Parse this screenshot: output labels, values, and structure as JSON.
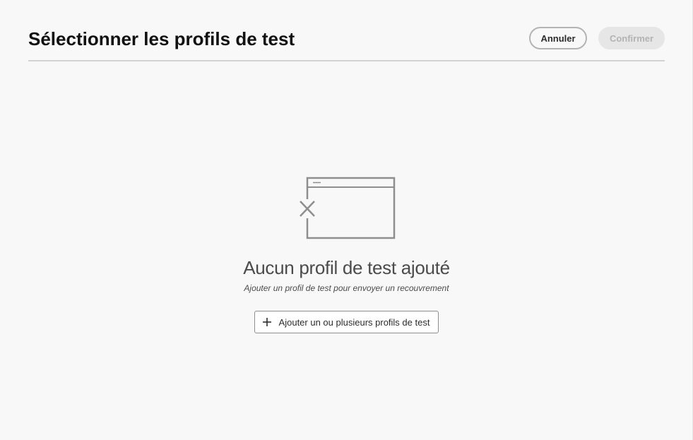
{
  "dialog": {
    "title": "Sélectionner les profils de test",
    "cancel_label": "Annuler",
    "confirm_label": "Confirmer"
  },
  "empty_state": {
    "icon": "browser-window-x-icon",
    "heading": "Aucun profil de test ajouté",
    "subtext": "Ajouter un profil de test pour envoyer un recouvrement",
    "add_button_icon": "plus-icon",
    "add_button_label": "Ajouter un ou plusieurs profils de test"
  },
  "colors": {
    "background": "#f8f8f8",
    "divider": "#d3d3d3",
    "disabled_button_bg": "#e6e6e6",
    "disabled_button_text": "#b3b3b3",
    "illustration_stroke": "#8e8e8e"
  }
}
